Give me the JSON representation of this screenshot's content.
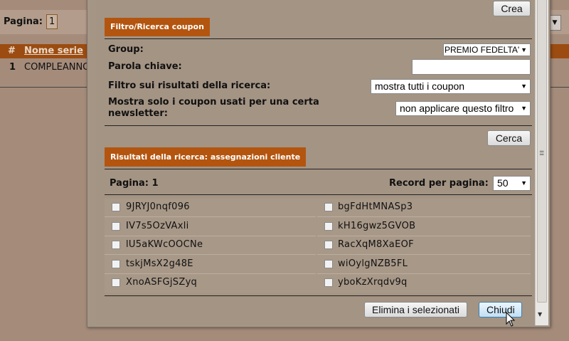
{
  "background": {
    "pagination_label": "Pagina:",
    "pagination_value": "1",
    "table": {
      "headers": [
        "#",
        "Nome serie"
      ],
      "rows": [
        {
          "num": "1",
          "name": "COMPLEANNO"
        }
      ]
    }
  },
  "dialog": {
    "create_button": "Crea",
    "filter_section_title": "Filtro/Ricerca coupon",
    "group_label": "Group:",
    "group_value": "PREMIO FEDELTA'",
    "keyword_label": "Parola chiave:",
    "keyword_value": "",
    "result_filter_label": "Filtro sui risultati della ricerca:",
    "result_filter_value": "mostra tutti i coupon",
    "newsletter_label_line1": "Mostra solo i coupon usati per una certa",
    "newsletter_label_line2": "newsletter:",
    "newsletter_value": "non applicare questo filtro",
    "search_button": "Cerca",
    "results_section_title": "Risultati della ricerca: assegnazioni cliente",
    "page_label": "Pagina: 1",
    "records_per_page_label": "Record per pagina:",
    "records_per_page_value": "50",
    "coupons_left": [
      "9JRYJ0nqf096",
      "IV7s5OzVAxli",
      "lU5aKWcOOCNe",
      "tskjMsX2g48E",
      "XnoASFGjSZyq"
    ],
    "coupons_right": [
      "bgFdHtMNASp3",
      "kH16gwz5GVOB",
      "RacXqM8XaEOF",
      "wiOylgNZB5FL",
      "yboKzXrqdv9q"
    ],
    "delete_selected_button": "Elimina i selezionati",
    "close_button": "Chiudi"
  }
}
